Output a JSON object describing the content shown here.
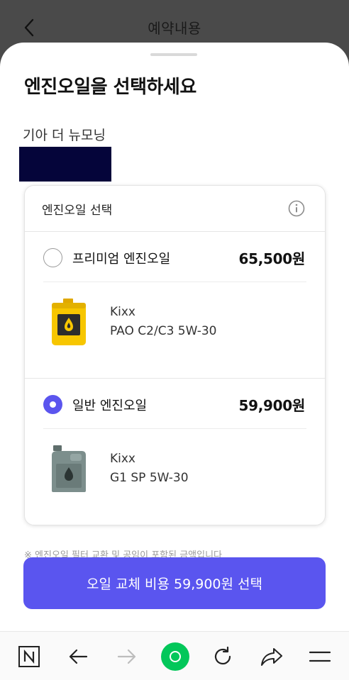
{
  "header": {
    "title": "예약내용",
    "back_icon": "chevron-left-icon"
  },
  "sheet": {
    "title": "엔진오일을 선택하세요",
    "car_name": "기아 더 뉴모닝"
  },
  "oil_card": {
    "title": "엔진오일 선택",
    "info_icon": "info-icon",
    "options": [
      {
        "label": "프리미엄 엔진오일",
        "price": "65,500원",
        "selected": false,
        "brand": "Kixx",
        "spec": "PAO C2/C3 5W-30",
        "image_icon": "yellow-oil-can-icon"
      },
      {
        "label": "일반 엔진오일",
        "price": "59,900원",
        "selected": true,
        "brand": "Kixx",
        "spec": "G1 SP 5W-30",
        "image_icon": "gray-oil-can-icon"
      }
    ]
  },
  "footnote": "※ 엔진오일 필터 교환 및 공임이 포함된 금액입니다",
  "cta": {
    "label": "오일 교체 비용 59,900원 선택"
  },
  "toolbar": {
    "items": [
      "naver-n-icon",
      "arrow-left-icon",
      "arrow-right-icon",
      "green-home-icon",
      "refresh-icon",
      "share-icon",
      "menu-icon"
    ]
  },
  "colors": {
    "accent": "#5a55ef",
    "header_bg": "#4a4a4a",
    "redacted": "#05053a",
    "home_green": "#03c75a"
  }
}
